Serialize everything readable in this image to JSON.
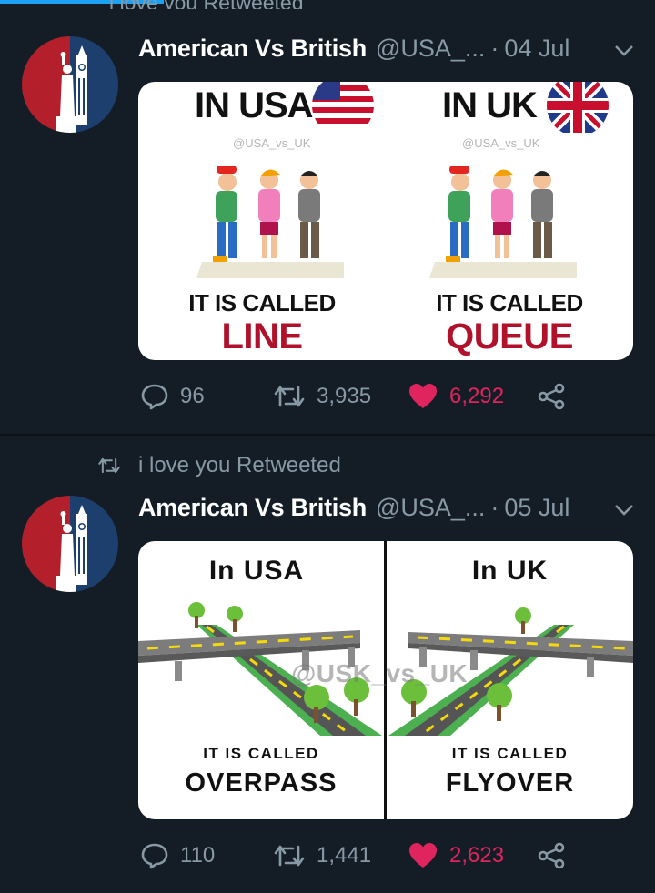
{
  "ghost_text": "i love you Retweeted",
  "tweets": [
    {
      "author_name": "American Vs British",
      "handle": "@USA_...",
      "dot": "·",
      "date": "04 Jul",
      "media": {
        "left_title": "IN USA",
        "right_title": "IN UK",
        "left_handle": "@USA_vs_UK",
        "right_handle": "@USA_vs_UK",
        "left_caption": "IT IS CALLED",
        "right_caption": "IT IS CALLED",
        "left_word": "LINE",
        "right_word": "QUEUE"
      },
      "replies": "96",
      "retweets": "3,935",
      "likes": "6,292"
    },
    {
      "retweeted_by": "i love you Retweeted",
      "author_name": "American Vs British",
      "handle": "@USA_...",
      "dot": "·",
      "date": "05 Jul",
      "media": {
        "left_title": "In USA",
        "right_title": "In UK",
        "watermark": "@USK_vs_UK",
        "left_caption": "IT IS CALLED",
        "right_caption": "IT IS CALLED",
        "left_word": "OVERPASS",
        "right_word": "FLYOVER"
      },
      "replies": "110",
      "retweets": "1,441",
      "likes": "2,623"
    }
  ],
  "colors": {
    "background": "#141d26",
    "accent": "#1da1f2",
    "muted": "#8899a6",
    "like": "#e0245e",
    "avatar_left": "#b31f2a",
    "avatar_right": "#1c3f6e"
  },
  "icons": [
    "retweet-icon",
    "chevron-down-icon",
    "reply-icon",
    "heart-icon",
    "share-icon"
  ]
}
